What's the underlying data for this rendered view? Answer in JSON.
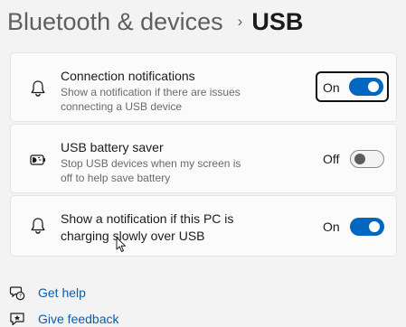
{
  "breadcrumb": {
    "parent": "Bluetooth & devices",
    "separator": "›",
    "current": "USB"
  },
  "settings": [
    {
      "title": "Connection notifications",
      "description_line1": "Show a notification if there are issues",
      "description_line2": "connecting a USB device",
      "state": "On",
      "toggle_on": true,
      "icon": "bell-icon",
      "focused": true
    },
    {
      "title": "USB battery saver",
      "description_line1": "Stop USB devices when my screen is",
      "description_line2": "off to help save battery",
      "state": "Off",
      "toggle_on": false,
      "icon": "battery-saver-icon"
    },
    {
      "title_line1": "Show a notification if this PC is",
      "title_line2": "charging slowly over USB",
      "state": "On",
      "toggle_on": true,
      "icon": "bell-icon"
    }
  ],
  "links": [
    {
      "label": "Get help",
      "icon": "help-icon"
    },
    {
      "label": "Give feedback",
      "icon": "feedback-icon"
    }
  ],
  "colors": {
    "accent": "#0067c0",
    "background": "#f3f3f3",
    "card": "#fbfbfb",
    "link": "#0b5cad"
  }
}
